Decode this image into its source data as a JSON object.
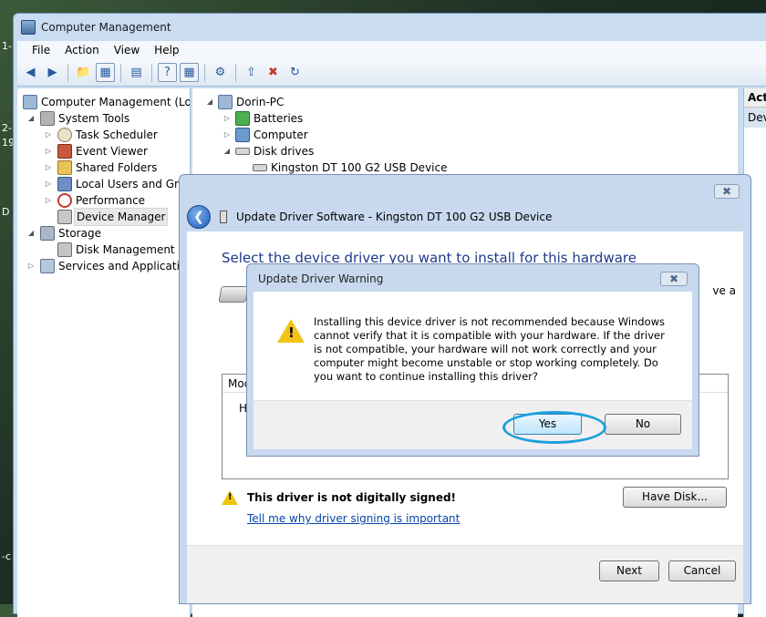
{
  "desktop": {
    "side_texts": [
      "1-",
      "2-",
      "19",
      "D",
      "-c"
    ]
  },
  "window": {
    "title": "Computer Management"
  },
  "menu": [
    "File",
    "Action",
    "View",
    "Help"
  ],
  "left_tree": [
    {
      "label": "Computer Management (Local",
      "depth": 0
    },
    {
      "label": "System Tools",
      "depth": 1
    },
    {
      "label": "Task Scheduler",
      "depth": 2
    },
    {
      "label": "Event Viewer",
      "depth": 2
    },
    {
      "label": "Shared Folders",
      "depth": 2
    },
    {
      "label": "Local Users and Grou",
      "depth": 2
    },
    {
      "label": "Performance",
      "depth": 2
    },
    {
      "label": "Device Manager",
      "depth": 2
    },
    {
      "label": "Storage",
      "depth": 1
    },
    {
      "label": "Disk Management",
      "depth": 2
    },
    {
      "label": "Services and Applications",
      "depth": 1
    }
  ],
  "center_tree": [
    {
      "label": "Dorin-PC"
    },
    {
      "label": "Batteries"
    },
    {
      "label": "Computer"
    },
    {
      "label": "Disk drives"
    },
    {
      "label": "Kingston DT 100 G2 USB Device"
    }
  ],
  "actions": {
    "header": "Act",
    "item": "Dev"
  },
  "update_dialog": {
    "title": "Update Driver Software - Kingston DT 100 G2 USB Device",
    "instruction": "Select the device driver you want to install for this hardware",
    "cut_text": "ve a",
    "model_header": "Mod",
    "model_row": "H",
    "warning": "This driver is not digitally signed!",
    "link": "Tell me why driver signing is important",
    "have_disk": "Have Disk...",
    "next": "Next",
    "cancel": "Cancel"
  },
  "warning_dialog": {
    "title": "Update Driver Warning",
    "message": "Installing this device driver is not recommended because Windows cannot verify that it is compatible with your hardware.  If the driver is not compatible, your hardware will not work correctly and your computer might become unstable or stop working completely.  Do you want to continue installing this driver?",
    "yes": "Yes",
    "no": "No"
  },
  "colors": {
    "highlight": "#1ca0dc",
    "link": "#0645ad",
    "instruction": "#1e3a8c"
  }
}
